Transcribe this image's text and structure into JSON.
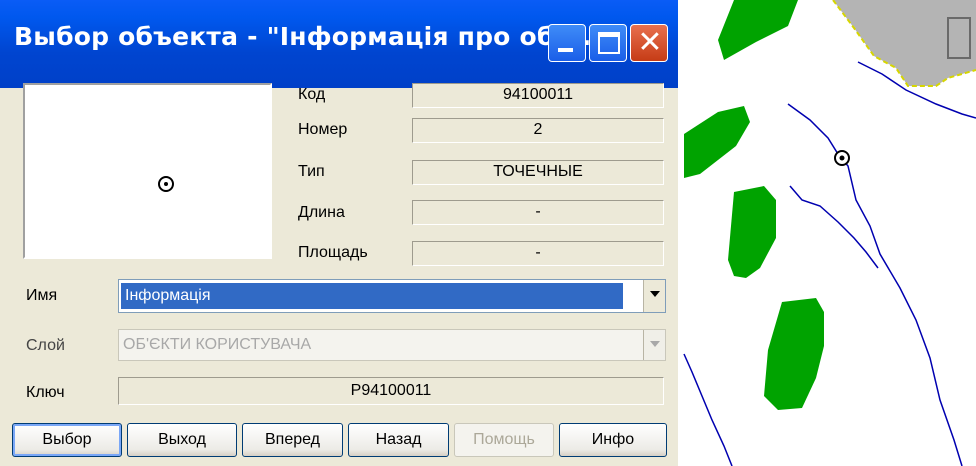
{
  "window": {
    "title": "Выбор объекта - \"Інформація про об'...",
    "title_bar_color": "#0a5cf6",
    "controls": [
      "minimize-icon",
      "maximize-icon",
      "close-icon"
    ],
    "close_glyph": "✕"
  },
  "properties": {
    "code": {
      "label": "Код",
      "value": "94100011"
    },
    "number": {
      "label": "Номер",
      "value": "2"
    },
    "type": {
      "label": "Тип",
      "value": "ТОЧЕЧНЫЕ"
    },
    "length": {
      "label": "Длина",
      "value": "-"
    },
    "area": {
      "label": "Площадь",
      "value": "-"
    }
  },
  "name_field": {
    "label": "Имя",
    "value": "Інформація",
    "highlight_color": "#316ac5"
  },
  "layer_field": {
    "label": "Слой",
    "value": "ОБ'ЄКТИ КОРИСТУВАЧА",
    "disabled": true
  },
  "key_field": {
    "label": "Ключ",
    "value": "P94100011"
  },
  "buttons": {
    "select": "Выбор",
    "exit": "Выход",
    "forward": "Вперед",
    "back": "Назад",
    "help": "Помощь",
    "info": "Инфо"
  },
  "map": {
    "background": "#ffffff",
    "vegetation_color": "#00a300",
    "built_area_color": "#b4b4b4",
    "river_color": "#0000b0",
    "boundary_color": "#d6d600"
  }
}
